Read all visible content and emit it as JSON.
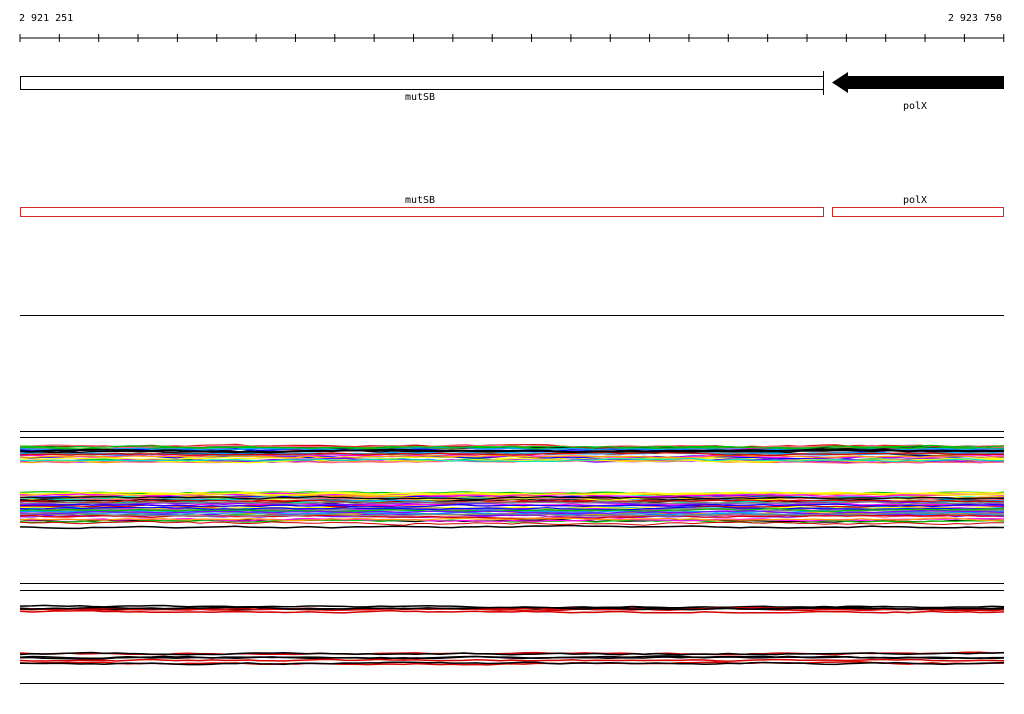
{
  "ruler": {
    "start_label": "2 921 251",
    "end_label": "2 923 750"
  },
  "genes": [
    {
      "name": "mutSB",
      "strand": "+",
      "fill": "#ffffff"
    },
    {
      "name": "polX",
      "strand": "-",
      "fill": "#000000"
    }
  ],
  "annotations": [
    {
      "name": "mutSB",
      "color": "#d42a2a"
    },
    {
      "name": "polX",
      "color": "#d42a2a"
    }
  ],
  "colors": {
    "axis": "#000000",
    "annotation_box": "#d42a2a",
    "tracks": [
      "#000000",
      "#d40000",
      "#00a0ff",
      "#00c000",
      "#ff00ff",
      "#ffa000",
      "#8000ff",
      "#ffff00",
      "#808080",
      "#0000ff",
      "#00e0c0",
      "#ff6080"
    ]
  }
}
